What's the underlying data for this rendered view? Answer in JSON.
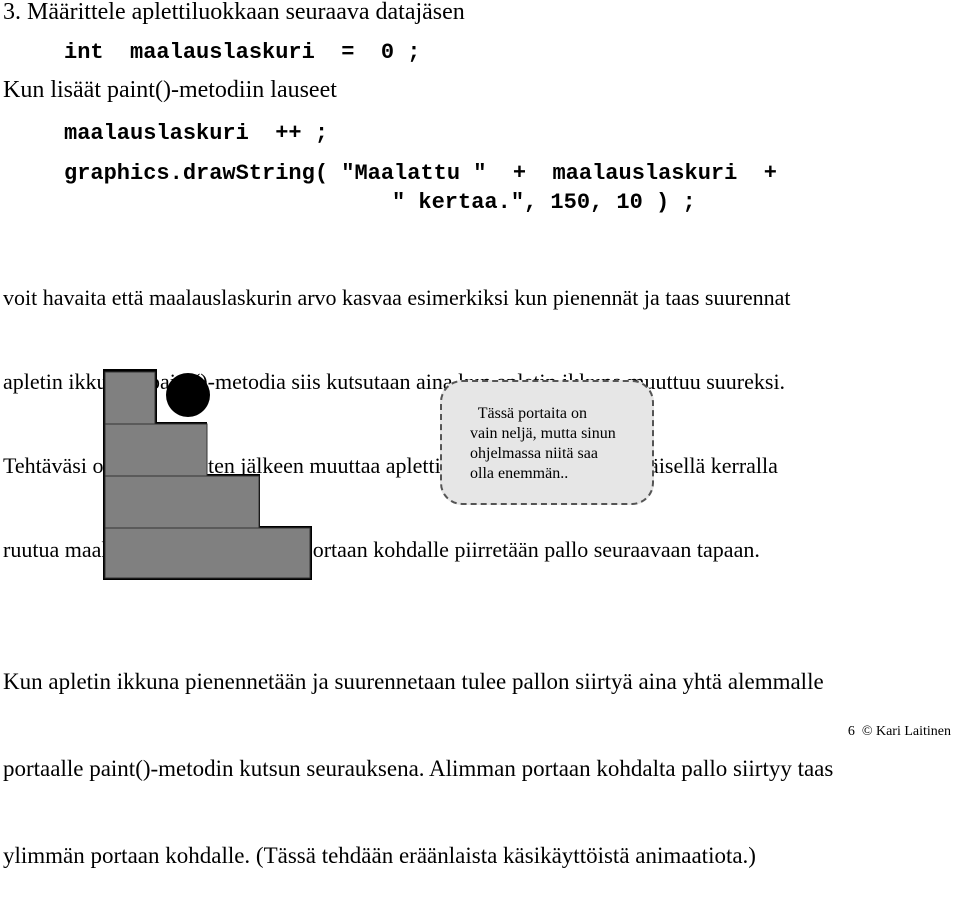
{
  "heading": "3. Määrittele aplettiluokkaan seuraava datajäsen",
  "code_declaration": "int  maalauslaskuri  =  0 ;",
  "intro_text": "Kun lisäät paint()-metodiin lauseet",
  "code_lines": [
    "maalauslaskuri  ++ ;",
    "graphics.drawString( \"Maalattu \"  +  maalauslaskuri  +",
    "\" kertaa.\", 150, 10 ) ;"
  ],
  "paragraph1_lines": [
    "voit havaita että maalauslaskurin arvo kasvaa esimerkiksi kun pienennät ja taas suurennat",
    "apletin ikkunaa. paint()-metodia siis kutsutaan aina kun apletin ikkuna muuttuu suureksi.",
    "Tehtäväsi on em. lisäysten jälkeen muuttaa apletti sellaiseksi että ensimmäisellä kerralla",
    "ruutua maalattaessa ensimmäisen portaan kohdalle piirretään pallo seuraavaan tapaan."
  ],
  "figure": {
    "stair_count": 4,
    "ball_on_step": 1,
    "stair_color": "#808080",
    "ball_color": "#000000"
  },
  "note": {
    "lines": [
      "  Tässä portaita on",
      "vain neljä, mutta sinun",
      "ohjelmassa niitä saa",
      "olla enemmän.."
    ],
    "background": "#e6e6e6"
  },
  "paragraph2_lines": [
    "Kun apletin ikkuna pienennetään ja suurennetaan tulee pallon siirtyä aina yhtä alemmalle",
    "portaalle paint()-metodin kutsun seurauksena. Alimman portaan kohdalta pallo siirtyy taas",
    "ylimmän portaan kohdalle. (Tässä tehdään eräänlaista käsikäyttöistä animaatiota.)"
  ],
  "footer": {
    "page_number": "6",
    "copyright": "© Kari Laitinen"
  }
}
